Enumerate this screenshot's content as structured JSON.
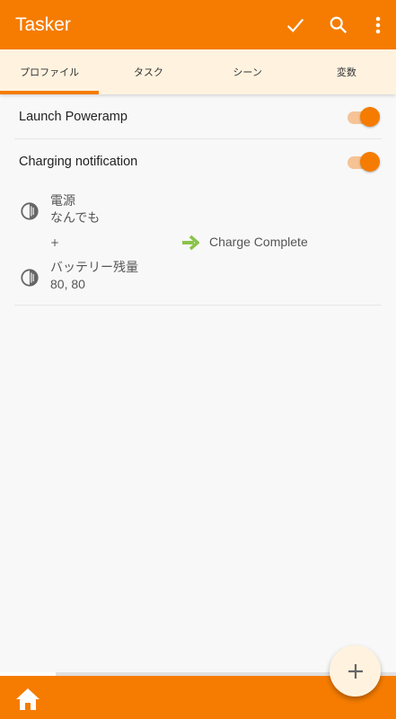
{
  "appbar": {
    "title": "Tasker",
    "actions": [
      "check-icon",
      "search-icon",
      "more-vert-icon"
    ]
  },
  "tabs": [
    {
      "label": "プロファイル",
      "active": true
    },
    {
      "label": "タスク",
      "active": false
    },
    {
      "label": "シーン",
      "active": false
    },
    {
      "label": "変数",
      "active": false
    }
  ],
  "profiles": [
    {
      "name": "Launch Poweramp",
      "enabled": true
    },
    {
      "name": "Charging notification",
      "enabled": true,
      "contexts": [
        {
          "icon": "half-circle-icon",
          "title": "電源",
          "detail": "なんでも"
        },
        {
          "icon": "half-circle-icon",
          "title": "バッテリー残量",
          "detail": "80, 80"
        }
      ],
      "plus": "+",
      "task": "Charge Complete"
    }
  ],
  "colors": {
    "primary": "#f57c00",
    "tab_bg": "#fff3e0",
    "arrow": "#8bc34a"
  },
  "fab": {
    "icon": "plus-icon"
  },
  "bottombar": {
    "icon": "home-icon"
  }
}
